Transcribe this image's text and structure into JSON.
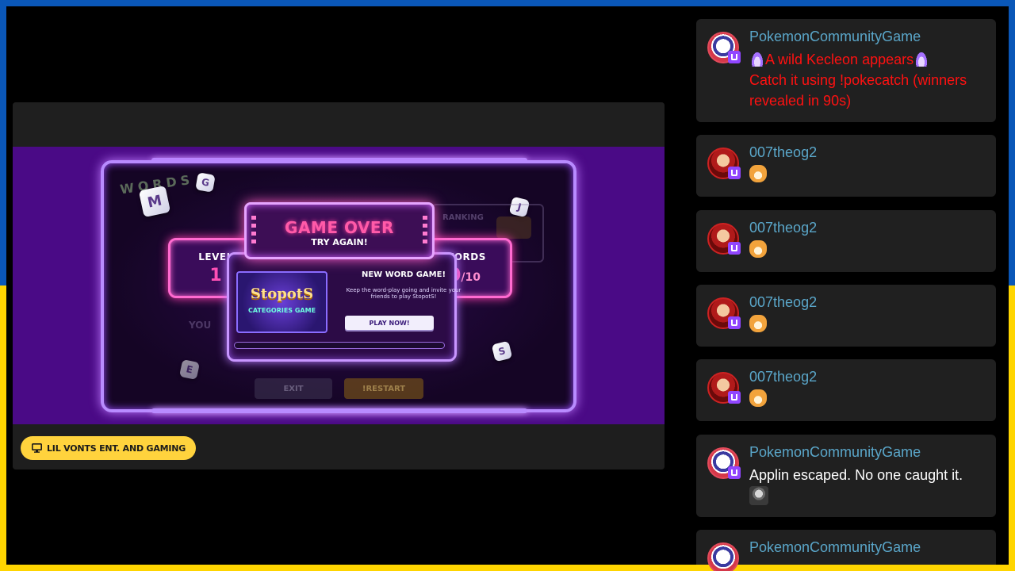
{
  "game": {
    "logo_text": "WORDS",
    "title": "GAME OVER",
    "subtitle": "TRY AGAIN!",
    "level_label": "LEVEL",
    "level_value": "1",
    "words_label": "WORDS",
    "words_value": "0",
    "words_total": "/10",
    "promo": {
      "logo": "StopotS",
      "sub": "CATEGORIES GAME",
      "title": "NEW WORD GAME!",
      "text": "Keep the word-play going and invite your friends to play StopotS!",
      "play_label": "PLAY NOW!"
    },
    "ghost": {
      "ranking": "RANKING",
      "you": "YOU",
      "exit": "EXIT",
      "restart": "!RESTART"
    },
    "dice": [
      "M",
      "G",
      "J",
      "S",
      "E"
    ]
  },
  "channel": {
    "name": "LIL VONTS ENT. AND GAMING",
    "icon": "monitor-icon"
  },
  "chat": {
    "messages": [
      {
        "user": "PokemonCommunityGame",
        "text": "A wild Kecleon appears",
        "text2": "Catch it using !pokecatch (winners revealed in 90s)",
        "style": "red"
      },
      {
        "user": "007theog2",
        "emote": "dog-emote"
      },
      {
        "user": "007theog2",
        "emote": "dog-emote"
      },
      {
        "user": "007theog2",
        "emote": "dog-emote"
      },
      {
        "user": "007theog2",
        "emote": "dog-emote"
      },
      {
        "user": "PokemonCommunityGame",
        "text": "Applin escaped. No one caught it."
      },
      {
        "user": "PokemonCommunityGame"
      }
    ]
  },
  "colors": {
    "flag_blue": "#0a57b8",
    "flag_yellow": "#ffd500",
    "username": "#5aa6c9",
    "alert_red": "#ff1111",
    "badge_yellow": "#ffd33d"
  }
}
